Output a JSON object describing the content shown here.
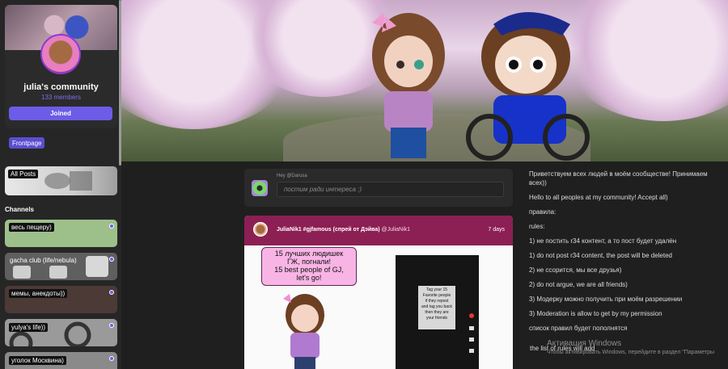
{
  "community": {
    "name": "julia's community",
    "members": "133 members",
    "join_button": "Joined"
  },
  "nav": {
    "frontpage": "Frontpage",
    "all_posts": "All Posts",
    "channels_title": "Channels"
  },
  "channels": [
    {
      "label": "весь пещеру)",
      "bg": "#9dc08b"
    },
    {
      "label": "gacha club (life/nebula)",
      "bg": "#5f5f5f"
    },
    {
      "label": "мемы, анекдоты))",
      "bg": "#4b3a35"
    },
    {
      "label": "yulya's life))",
      "bg": "#9a9a9a"
    },
    {
      "label": "уголок Москвина)",
      "bg": "#8a8a8a"
    }
  ],
  "composer": {
    "hey": "Hey @Darusa",
    "placeholder": "постим ради интереса :)"
  },
  "post": {
    "title": "JuliaNik1 #gjfamous (спрей от Дэйва)",
    "author": "@JuliaNik1",
    "time": "7 days",
    "bubble_lines": [
      "15 лучших людишек",
      "ГЖ, погнали!",
      "15 best people of GJ,",
      "let's go!"
    ],
    "phone_lines": [
      "Tag your 15",
      "Favorite people",
      "if they repost",
      "and tag you back",
      "then they are",
      "your friends"
    ]
  },
  "rules": [
    "Приветствуем всех людей в моём сообществе! Принимаем всех))",
    "Hello to all peoples at my community! Accept all)",
    "правила:",
    "rules:",
    "1) не постить r34 контент, а то пост будет удалён",
    "1) do not post r34 content, the post will be deleted",
    "2) не ссорится, мы все друзья)",
    "2) do not argue, we are all friends)",
    "3) Модерку можно получить при моём разрешении",
    "3) Moderation is allow to get by my permission",
    "список правил будет пополнятся"
  ],
  "rules_last": "the list of rules will add",
  "watermark": {
    "title": "Активация Windows",
    "subtitle": "Чтобы активировать Windows, перейдите в раздел \"Параметры"
  },
  "colors": {
    "accent": "#6c5ce7",
    "post_header": "#8c1f54",
    "background": "#1f1f1f"
  }
}
